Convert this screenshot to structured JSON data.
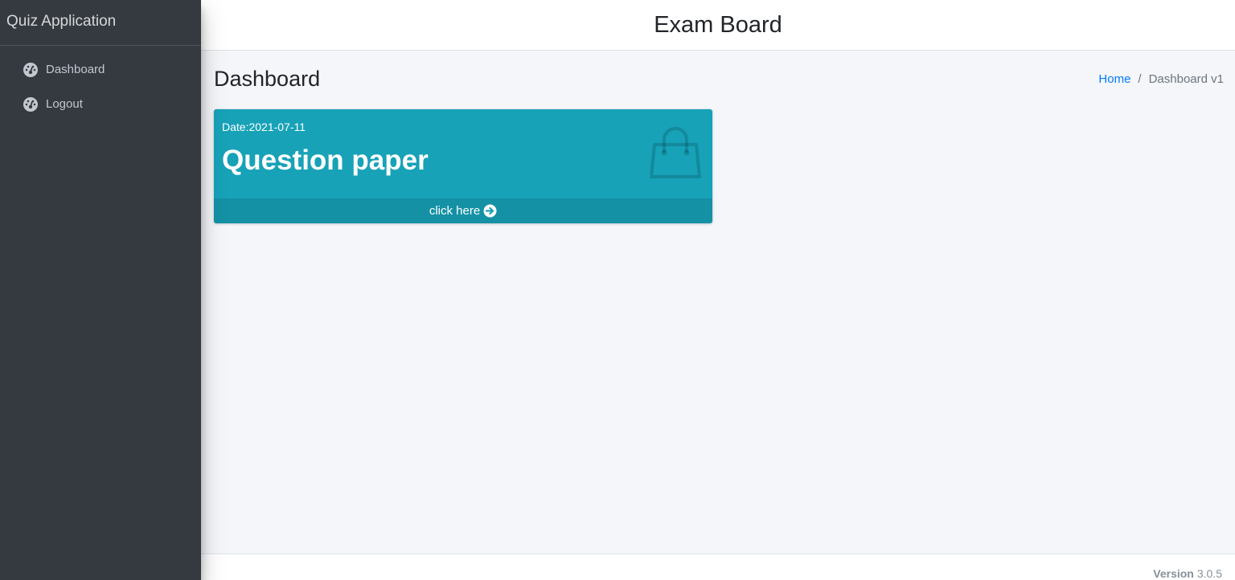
{
  "sidebar": {
    "brand": "Quiz Application",
    "items": [
      {
        "label": "Dashboard",
        "icon": "tachometer-icon"
      },
      {
        "label": "Logout",
        "icon": "tachometer-icon"
      }
    ]
  },
  "header": {
    "title": "Exam Board"
  },
  "content": {
    "title": "Dashboard",
    "breadcrumb": {
      "home": "Home",
      "separator": "/",
      "current": "Dashboard v1"
    }
  },
  "card": {
    "date": "Date:2021-07-11",
    "title": "Question paper",
    "icon": "shopping-bag-icon",
    "footer_label": "click here",
    "footer_icon": "arrow-circle-right-icon",
    "color": "#17a2b8"
  },
  "footer": {
    "version_label": "Version",
    "version": "3.0.5"
  }
}
